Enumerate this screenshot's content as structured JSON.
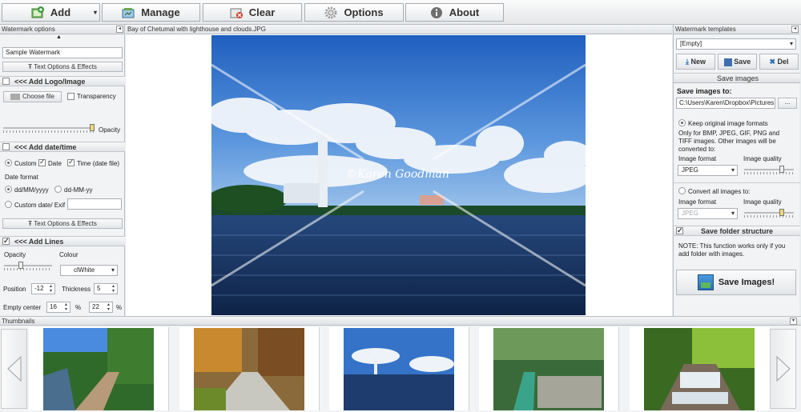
{
  "toolbar": {
    "add": "Add",
    "manage": "Manage",
    "clear": "Clear",
    "options": "Options",
    "about": "About"
  },
  "left": {
    "title": "Watermark options",
    "text_placeholder": "Sample Watermark",
    "text_effects": "Text Options & Effects",
    "logo_header": "<<< Add Logo/Image",
    "choose_file": "Choose file",
    "transparency": "Transparency",
    "opacity": "Opacity",
    "date_header": "<<< Add date/time",
    "date_opt1": "Custom",
    "date_opt2": "Date",
    "date_opt3": "Time (date file)",
    "date_format": "Date format",
    "fmt1": "dd/MM/yyyy",
    "fmt2": "dd-MM-yy",
    "custom_date": "Custom date/ Exif",
    "text_effects2": "Text Options & Effects",
    "lines_header": "<<< Add Lines",
    "lines_opacity": "Opacity",
    "colour": "Colour",
    "colour_value": "clWhite",
    "position": "Position",
    "position_value": "-12",
    "thickness": "Thickness",
    "thickness_value": "5",
    "empty_center": "Empty center",
    "empty_x": "16",
    "empty_y": "22",
    "pct": "%"
  },
  "center": {
    "filename": "Bay of Chetumal with lighthouse and clouds.JPG",
    "watermark_text": "©Karen Goodman"
  },
  "right": {
    "title": "Watermark templates",
    "template_value": "[Empty]",
    "new": "New",
    "save": "Save",
    "del": "Del",
    "save_images_bar": "Save images",
    "save_to_label": "Save images to:",
    "save_path": "C:\\Users\\Karen\\Dropbox\\Pictures",
    "browse": "...",
    "keep_formats": "Keep original image formats",
    "keep_note": "Only for BMP, JPEG, GIF, PNG and TIFF images. Other images will be converted to:",
    "image_format": "Image format",
    "image_quality": "Image quality",
    "format_value": "JPEG",
    "convert_all": "Convert all images to:",
    "image_format2": "Image format",
    "image_quality2": "Image quality",
    "format_value2": "JPEG",
    "save_folder": "Save folder structure",
    "note": "NOTE: This function works only if you add folder with images.",
    "save_button": "Save Images!"
  },
  "thumbs": {
    "title": "Thumbnails"
  },
  "colors": {
    "accent_green": "#3a9a3a",
    "clear_red": "#d23c2a",
    "sky": "#3a78c8"
  }
}
